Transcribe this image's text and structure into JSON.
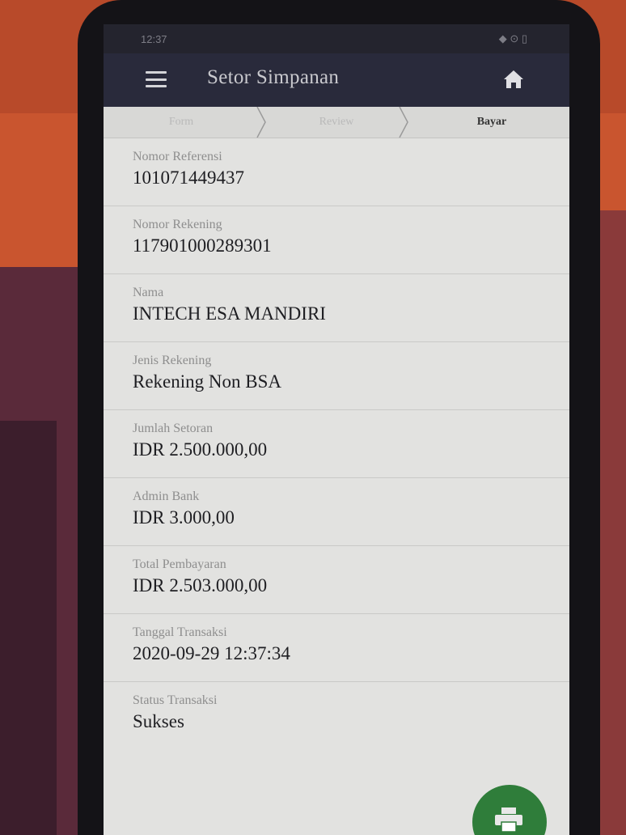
{
  "status_bar": {
    "time": "12:37",
    "indicators": "◆ ⊙ ▯"
  },
  "app_bar": {
    "title": "Setor Simpanan",
    "menu_icon": "hamburger-menu-icon",
    "home_icon": "home-icon"
  },
  "steps": [
    {
      "label": "Form",
      "active": false
    },
    {
      "label": "Review",
      "active": false
    },
    {
      "label": "Bayar",
      "active": true
    }
  ],
  "fields": [
    {
      "label": "Nomor Referensi",
      "value": "101071449437"
    },
    {
      "label": "Nomor Rekening",
      "value": "117901000289301"
    },
    {
      "label": "Nama",
      "value": "INTECH ESA MANDIRI"
    },
    {
      "label": "Jenis Rekening",
      "value": "Rekening Non BSA"
    },
    {
      "label": "Jumlah Setoran",
      "value": "IDR 2.500.000,00"
    },
    {
      "label": "Admin Bank",
      "value": "IDR 3.000,00"
    },
    {
      "label": "Total Pembayaran",
      "value": "IDR 2.503.000,00"
    },
    {
      "label": "Tanggal Transaksi",
      "value": "2020-09-29 12:37:34"
    },
    {
      "label": "Status Transaksi",
      "value": "Sukses"
    }
  ],
  "fab": {
    "icon": "print-icon",
    "color": "#2f7d3a"
  },
  "colors": {
    "app_bar": "#292a3b",
    "status_bar": "#24242e",
    "screen_bg": "#e2e2e0"
  }
}
